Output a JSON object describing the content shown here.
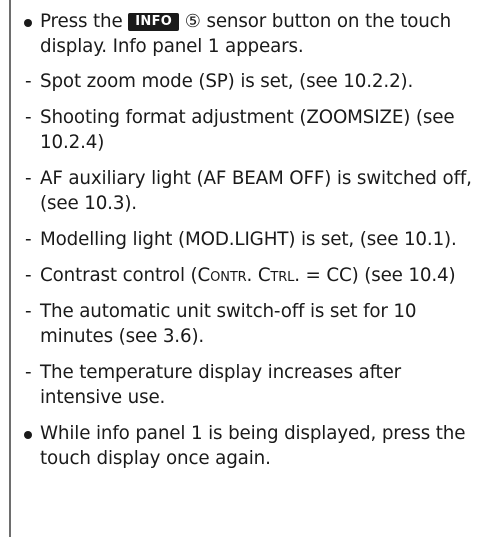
{
  "items": [
    {
      "type": "bullet",
      "before_badge": "Press the ",
      "badge": "INFO",
      "circled_number": "⑤",
      "after_badge": " sensor button on the touch display. Info panel 1 appears."
    },
    {
      "type": "dash",
      "marker": "-",
      "text": "Spot zoom mode (SP) is set, (see 10.2.2)."
    },
    {
      "type": "dash",
      "marker": "-",
      "text": "Shooting format adjustment  (ZOOMSIZE) (see 10.2.4)"
    },
    {
      "type": "dash",
      "marker": "-",
      "text": "AF auxiliary light (AF BEAM OFF) is switched off, (see 10.3)."
    },
    {
      "type": "dash",
      "marker": "-",
      "text": "Modelling light (MOD.LIGHT) is set, (see 10.1)."
    },
    {
      "type": "dash",
      "marker": "-",
      "text_prefix": "Contrast control (",
      "smallcaps": "Contr. Ctrl.",
      "text_suffix": " = CC) (see 10.4)"
    },
    {
      "type": "dash",
      "marker": "-",
      "text": "The automatic unit switch-off is set for 10 minutes (see 3.6)."
    },
    {
      "type": "dash",
      "marker": "-",
      "text": "The temperature display increases after intensive use."
    },
    {
      "type": "bullet",
      "text": "While info panel 1 is being displayed, press the touch display once again."
    }
  ],
  "colors": {
    "text": "#1a1a1a",
    "rule": "#6e6e6e",
    "badge_bg": "#1a1a1a",
    "badge_fg": "#ffffff"
  }
}
